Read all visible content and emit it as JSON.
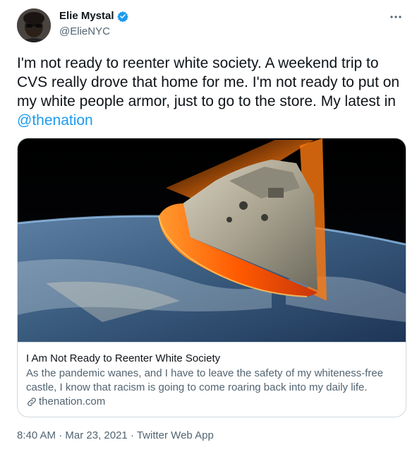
{
  "author": {
    "name": "Elie Mystal",
    "handle": "@ElieNYC"
  },
  "tweet": {
    "text": "I'm not ready to reenter white society. A weekend trip to CVS really drove that home for me. I'm not ready to put on my white people armor, just to go to the store. My latest in ",
    "mention": "@thenation"
  },
  "card": {
    "title": "I Am Not Ready to Reenter White Society",
    "description": "As the pandemic wanes, and I have to leave the safety of my whiteness-free castle, I know that racism is going to come roaring back into my daily life.",
    "domain": "thenation.com"
  },
  "meta": {
    "time": "8:40 AM",
    "separator1": " · ",
    "date": "Mar 23, 2021",
    "separator2": " · ",
    "source": "Twitter Web App"
  },
  "colors": {
    "accent": "#1d9bf0",
    "secondary_text": "#536471",
    "border": "#cfd9de"
  },
  "icons": {
    "verified": "verified-badge-icon",
    "more": "more-options-icon",
    "link": "link-icon"
  }
}
